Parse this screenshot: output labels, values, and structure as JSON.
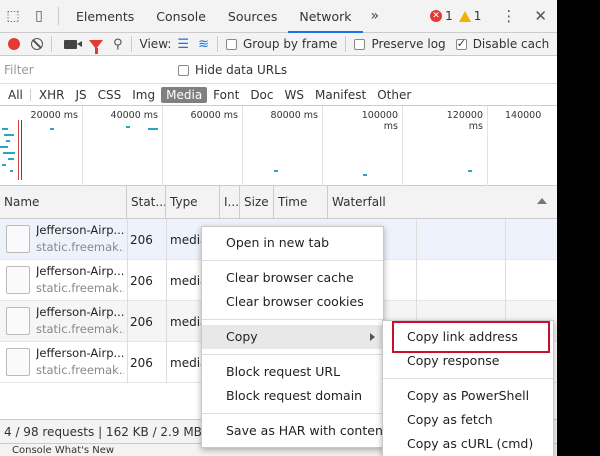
{
  "tabs": {
    "items": [
      {
        "label": "Elements"
      },
      {
        "label": "Console"
      },
      {
        "label": "Sources"
      },
      {
        "label": "Network",
        "active": true
      }
    ],
    "more": "»",
    "errors": "1",
    "warnings": "1"
  },
  "toolbar": {
    "view_label": "View:",
    "group_by_frame": "Group by frame",
    "preserve_log": "Preserve log",
    "disable_cache": "Disable cach"
  },
  "filter": {
    "placeholder": "Filter",
    "hide_data_urls": "Hide data URLs"
  },
  "types": [
    "All",
    "XHR",
    "JS",
    "CSS",
    "Img",
    "Media",
    "Font",
    "Doc",
    "WS",
    "Manifest",
    "Other"
  ],
  "active_type": "Media",
  "overview": {
    "ticks": [
      "20000 ms",
      "40000 ms",
      "60000 ms",
      "80000 ms",
      "100000 ms",
      "120000 ms",
      "140000"
    ]
  },
  "table": {
    "columns": [
      "Name",
      "Stat...",
      "Type",
      "I...",
      "Size",
      "Time",
      "Waterfall"
    ],
    "rows": [
      {
        "name": "Jefferson-Airp...",
        "domain": "static.freemak...",
        "status": "206",
        "type": "media"
      },
      {
        "name": "Jefferson-Airp...",
        "domain": "static.freemak...",
        "status": "206",
        "type": "media"
      },
      {
        "name": "Jefferson-Airp...",
        "domain": "static.freemak...",
        "status": "206",
        "type": "media"
      },
      {
        "name": "Jefferson-Airp...",
        "domain": "static.freemak...",
        "status": "206",
        "type": "media"
      }
    ]
  },
  "statusbar": {
    "text": "4 / 98 requests  |  162 KB / 2.9 MB tra"
  },
  "drawer": {
    "text": "Console   What's New"
  },
  "context_menu": {
    "items": [
      "Open in new tab",
      "Clear browser cache",
      "Clear browser cookies",
      "Copy",
      "Block request URL",
      "Block request domain",
      "Save as HAR with content"
    ]
  },
  "copy_submenu": {
    "items": [
      "Copy link address",
      "Copy response",
      "Copy as PowerShell",
      "Copy as fetch",
      "Copy as cURL (cmd)"
    ]
  },
  "colors": {
    "accent": "#1a73e8",
    "record": "#e53935",
    "highlight": "#c8102e"
  }
}
